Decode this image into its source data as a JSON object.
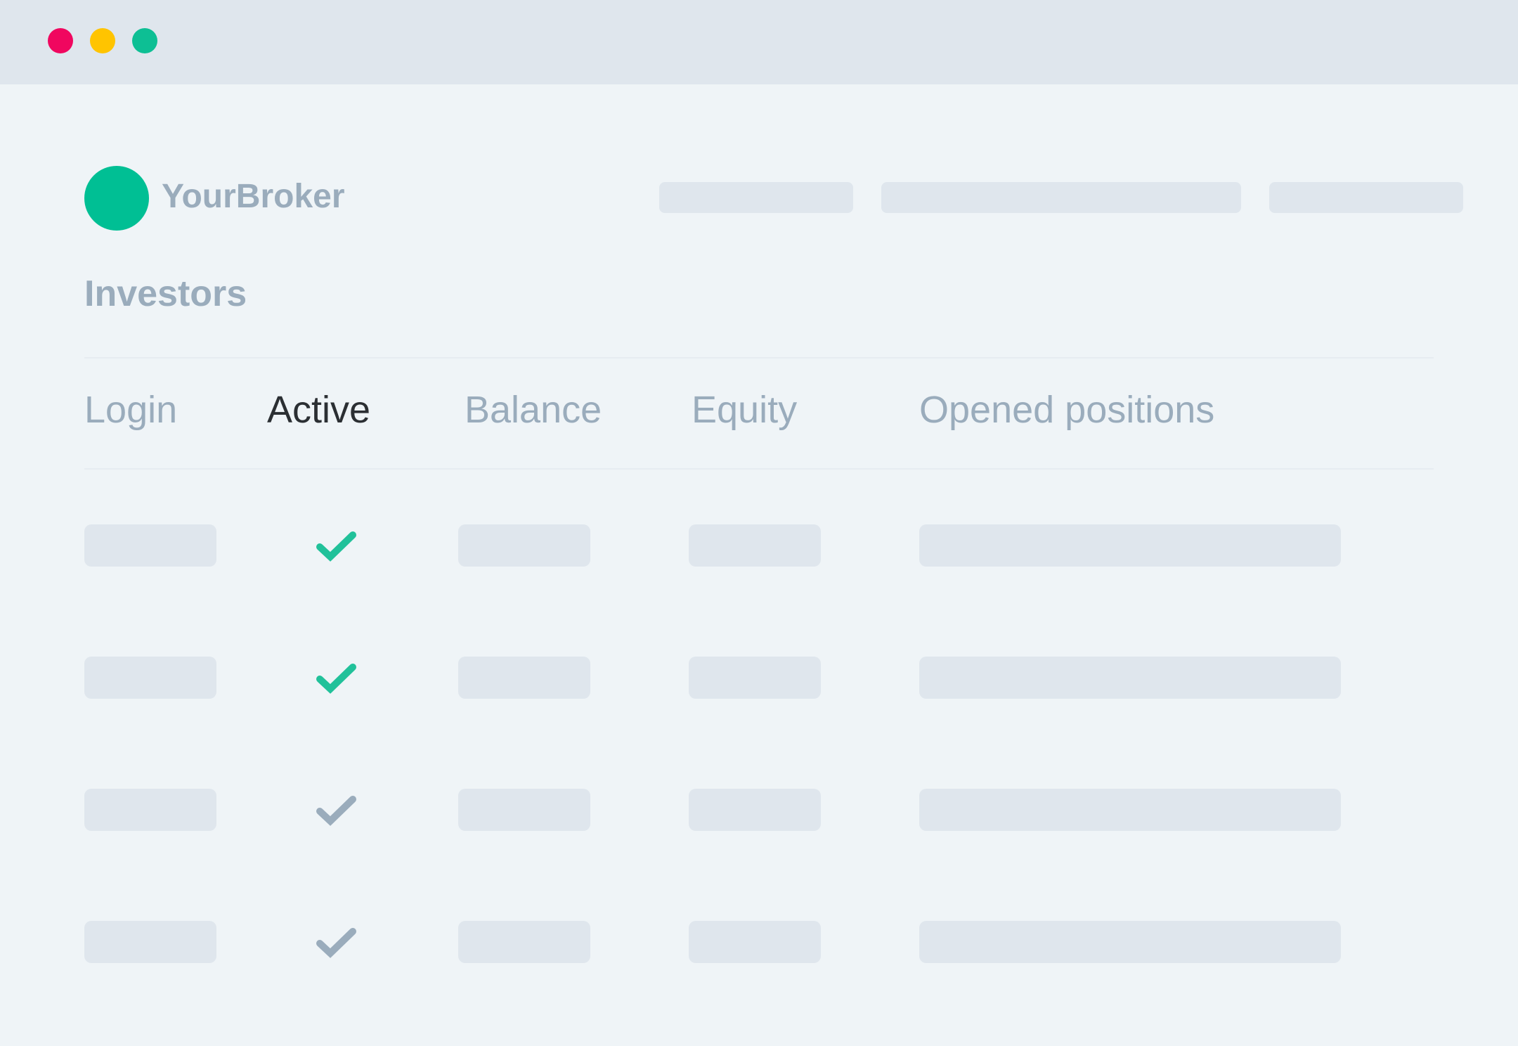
{
  "colors": {
    "close": "#f0075f",
    "minimize": "#ffc400",
    "maximize": "#0dbf94",
    "brand": "#00bf94",
    "check_active": "#21c19a",
    "check_inactive": "#9aacbc"
  },
  "brand": {
    "name": "YourBroker",
    "logo_icon": "brand-circle"
  },
  "page": {
    "title": "Investors"
  },
  "table": {
    "headers": [
      "Login",
      "Active",
      "Balance",
      "Equity",
      "Opened positions"
    ],
    "active_header_index": 1,
    "rows": [
      {
        "active": true,
        "check_icon": "checkmark-icon"
      },
      {
        "active": true,
        "check_icon": "checkmark-icon"
      },
      {
        "active": false,
        "check_icon": "checkmark-icon"
      },
      {
        "active": false,
        "check_icon": "checkmark-icon"
      }
    ]
  }
}
